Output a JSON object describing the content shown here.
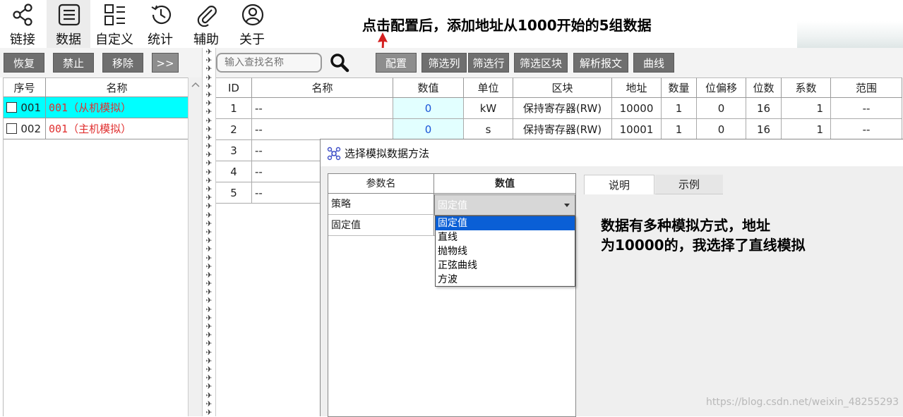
{
  "nav": {
    "items": [
      {
        "label": "链接",
        "icon": "share-icon"
      },
      {
        "label": "数据",
        "icon": "list-icon"
      },
      {
        "label": "自定义",
        "icon": "customize-icon"
      },
      {
        "label": "统计",
        "icon": "history-icon"
      },
      {
        "label": "辅助",
        "icon": "paperclip-icon"
      },
      {
        "label": "关于",
        "icon": "user-icon"
      }
    ]
  },
  "annotation_top": "点击配置后，添加地址从1000开始的5组数据",
  "toolbar": {
    "restore": "恢复",
    "disable": "禁止",
    "remove": "移除",
    "expand": ">>",
    "search_placeholder": "输入查找名称",
    "config": "配置",
    "filter_columns": "筛选列",
    "filter_rows": "筛选行",
    "filter_block": "筛选区块",
    "parse_message": "解析报文",
    "curve": "曲线"
  },
  "left_table": {
    "headers": [
      "序号",
      "名称"
    ],
    "rows": [
      {
        "no": "001",
        "name": "001（从机模拟）"
      },
      {
        "no": "002",
        "name": "001（主机模拟）"
      }
    ]
  },
  "grid": {
    "headers": [
      "ID",
      "名称",
      "数值",
      "单位",
      "区块",
      "地址",
      "数量",
      "位偏移",
      "位数",
      "系数",
      "范围"
    ],
    "rows": [
      {
        "id": "1",
        "name": "--",
        "value": "0",
        "unit": "kW",
        "block": "保持寄存器(RW)",
        "addr": "10000",
        "count": "1",
        "bitoff": "0",
        "bits": "16",
        "coef": "1",
        "range": "--"
      },
      {
        "id": "2",
        "name": "--",
        "value": "0",
        "unit": "s",
        "block": "保持寄存器(RW)",
        "addr": "10001",
        "count": "1",
        "bitoff": "0",
        "bits": "16",
        "coef": "1",
        "range": "--"
      },
      {
        "id": "3",
        "name": "--"
      },
      {
        "id": "4",
        "name": "--"
      },
      {
        "id": "5",
        "name": "--"
      }
    ]
  },
  "dialog": {
    "title": "选择模拟数据方法",
    "param_headers": [
      "参数名",
      "数值"
    ],
    "params": [
      {
        "name": "策略",
        "value": "固定值"
      },
      {
        "name": "固定值",
        "value": ""
      }
    ],
    "options": [
      "固定值",
      "直线",
      "抛物线",
      "正弦曲线",
      "方波"
    ],
    "tabs": [
      "说明",
      "示例"
    ],
    "annotation": [
      "数据有多种模拟方式，地址",
      "为10000的，我选择了直线模拟"
    ]
  },
  "watermark": "https://blog.csdn.net/weixin_48255293",
  "colors": {
    "accent_cyan": "#00ffff",
    "red_text": "#e03030",
    "blue_value": "#1a55d8",
    "selection": "#0a5fd6"
  }
}
